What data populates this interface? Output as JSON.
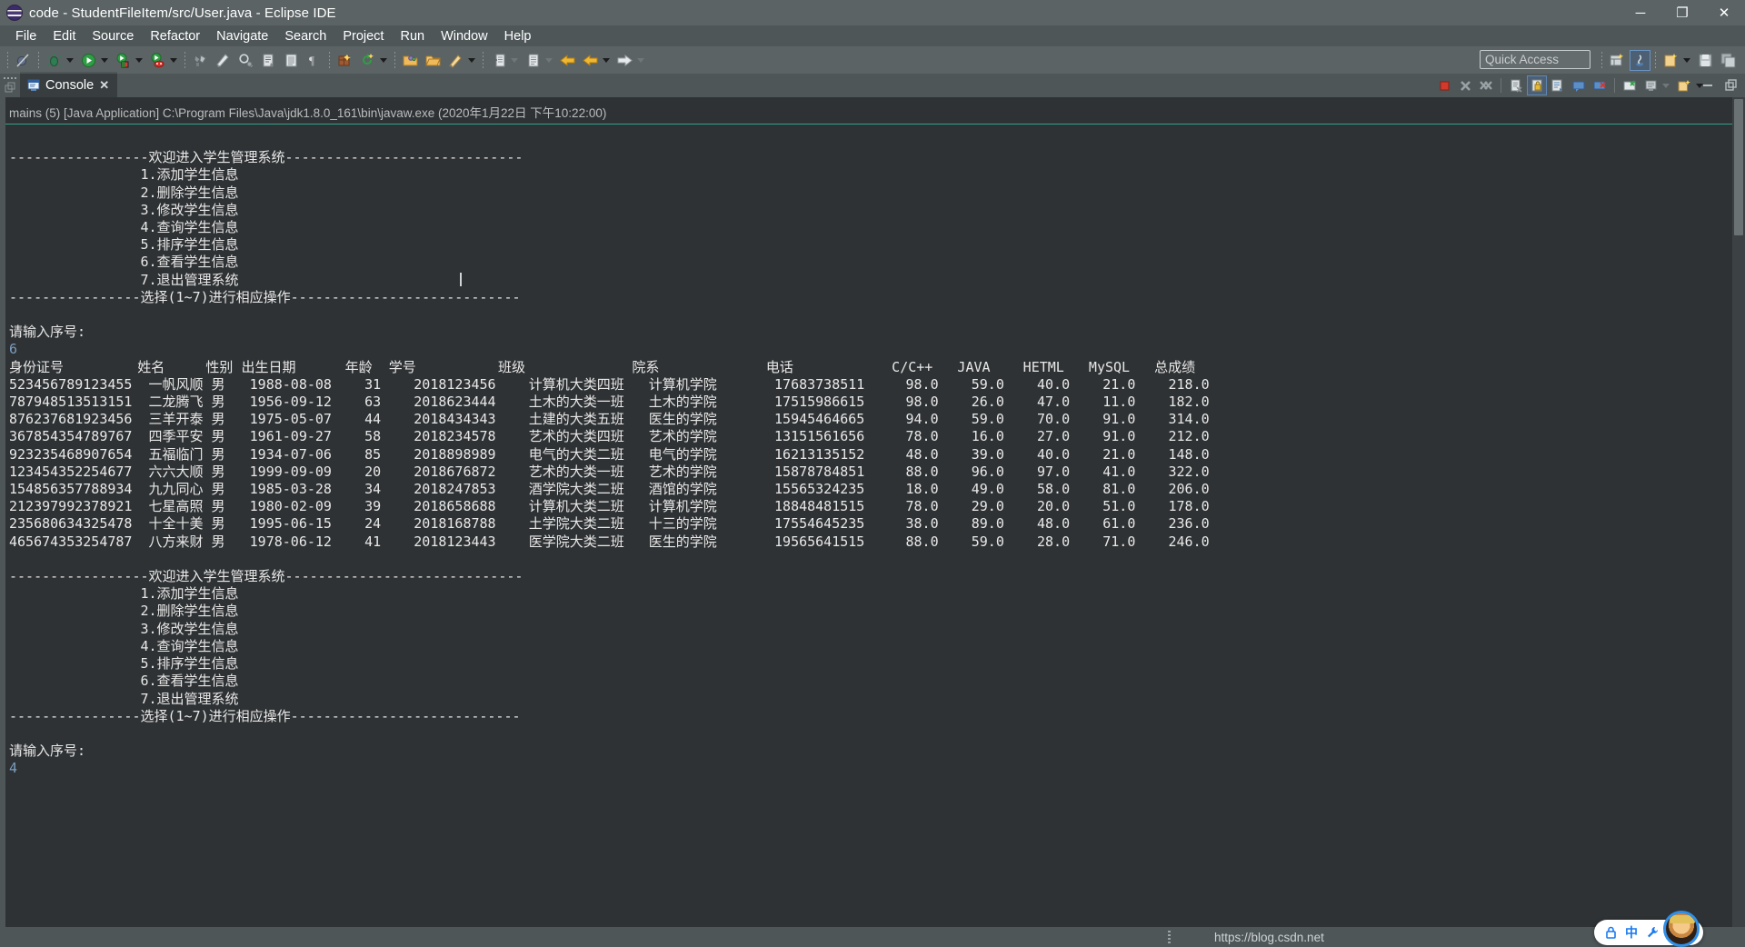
{
  "window": {
    "title": "code - StudentFileItem/src/User.java - Eclipse IDE",
    "app_icon": "eclipse-icon",
    "buttons": {
      "minimize": "─",
      "maximize": "❐",
      "close": "✕"
    }
  },
  "menubar": {
    "items": [
      "File",
      "Edit",
      "Source",
      "Refactor",
      "Navigate",
      "Search",
      "Project",
      "Run",
      "Window",
      "Help"
    ]
  },
  "toolbar": {
    "quick_access_placeholder": "Quick Access",
    "icons": [
      "toggle-breakpoint-icon",
      "debug-icon",
      "run-icon",
      "run-last-tool-icon",
      "external-tools-icon",
      "new-java-project-icon",
      "open-type-icon",
      "search-icon",
      "next-annotation-icon",
      "previous-annotation-icon",
      "paragraph-mark-icon",
      "new-package-icon",
      "refresh-icon",
      "open-folder-icon",
      "open-resource-icon",
      "edit-icon",
      "export-icon",
      "import-icon",
      "back-icon",
      "forward-icon",
      "step-icon"
    ],
    "perspective_icons": [
      "open-perspective-icon",
      "java-perspective-icon",
      "new-wizard-icon",
      "save-icon",
      "save-all-icon"
    ]
  },
  "view": {
    "tab_label": "Console",
    "tab_icon": "console-icon",
    "tab_close": "✕",
    "toolbar_icons": [
      "terminate-icon",
      "remove-launch-icon",
      "remove-all-terminated-icon",
      "clear-console-icon",
      "scroll-lock-icon",
      "word-wrap-icon",
      "show-console-on-output-icon",
      "show-console-on-error-icon",
      "pin-console-icon",
      "display-selected-console-icon",
      "open-console-icon"
    ],
    "minimize_label": "─",
    "maximize_label": "⧉"
  },
  "console": {
    "launch_line": "mains (5) [Java Application] C:\\Program Files\\Java\\jdk1.8.0_161\\bin\\javaw.exe (2020年1月22日 下午10:22:00)",
    "menu_header": "-----------------欢迎进入学生管理系统-----------------------------",
    "menu_items": [
      "                1.添加学生信息",
      "                2.删除学生信息",
      "                3.修改学生信息",
      "                4.查询学生信息",
      "                5.排序学生信息",
      "                6.查看学生信息",
      "                7.退出管理系统"
    ],
    "menu_footer": "----------------选择(1~7)进行相应操作----------------------------",
    "prompt": "请输入序号:",
    "input_first": "6",
    "input_last": "4"
  },
  "table": {
    "headers": [
      "身份证号",
      "姓名",
      "性别",
      "出生日期",
      "年龄",
      "学号",
      "班级",
      "院系",
      "电话",
      "C/C++",
      "JAVA",
      "HETML",
      "MySQL",
      "总成绩"
    ],
    "rows": [
      [
        "523456789123455",
        "一帆风顺",
        "男",
        "1988-08-08",
        "31",
        "2018123456",
        "计算机大类四班",
        "计算机学院",
        "17683738511",
        "98.0",
        "59.0",
        "40.0",
        "21.0",
        "218.0"
      ],
      [
        "787948513513151",
        "二龙腾飞",
        "男",
        "1956-09-12",
        "63",
        "2018623444",
        "土木的大类一班",
        "土木的学院",
        "17515986615",
        "98.0",
        "26.0",
        "47.0",
        "11.0",
        "182.0"
      ],
      [
        "876237681923456",
        "三羊开泰",
        "男",
        "1975-05-07",
        "44",
        "2018434343",
        "土建的大类五班",
        "医生的学院",
        "15945464665",
        "94.0",
        "59.0",
        "70.0",
        "91.0",
        "314.0"
      ],
      [
        "367854354789767",
        "四季平安",
        "男",
        "1961-09-27",
        "58",
        "2018234578",
        "艺术的大类四班",
        "艺术的学院",
        "13151561656",
        "78.0",
        "16.0",
        "27.0",
        "91.0",
        "212.0"
      ],
      [
        "923235468907654",
        "五福临门",
        "男",
        "1934-07-06",
        "85",
        "2018898989",
        "电气的大类二班",
        "电气的学院",
        "16213135152",
        "48.0",
        "39.0",
        "40.0",
        "21.0",
        "148.0"
      ],
      [
        "123454352254677",
        "六六大顺",
        "男",
        "1999-09-09",
        "20",
        "2018676872",
        "艺术的大类一班",
        "艺术的学院",
        "15878784851",
        "88.0",
        "96.0",
        "97.0",
        "41.0",
        "322.0"
      ],
      [
        "154856357788934",
        "九九同心",
        "男",
        "1985-03-28",
        "34",
        "2018247853",
        "酒学院大类二班",
        "酒馆的学院",
        "15565324235",
        "18.0",
        "49.0",
        "58.0",
        "81.0",
        "206.0"
      ],
      [
        "212397992378921",
        "七星高照",
        "男",
        "1980-02-09",
        "39",
        "2018658688",
        "计算机大类二班",
        "计算机学院",
        "18848481515",
        "78.0",
        "29.0",
        "20.0",
        "51.0",
        "178.0"
      ],
      [
        "235680634325478",
        "十全十美",
        "男",
        "1995-06-15",
        "24",
        "2018168788",
        "土学院大类二班",
        "十三的学院",
        "17554645235",
        "38.0",
        "89.0",
        "48.0",
        "61.0",
        "236.0"
      ],
      [
        "465674353254787",
        "八方来财",
        "男",
        "1978-06-12",
        "41",
        "2018123443",
        "医学院大类二班",
        "医生的学院",
        "19565641515",
        "88.0",
        "59.0",
        "28.0",
        "71.0",
        "246.0"
      ]
    ]
  },
  "statusbar": {
    "url": "https://blog.csdn.net"
  },
  "ime": {
    "lock_icon": "lock-icon",
    "mode": "中",
    "tools_icon": "wrench-icon",
    "avatar": "user-avatar"
  },
  "colors": {
    "window_chrome": "#4e5658",
    "titlebar": "#5b6365",
    "console_bg": "#2f3234",
    "console_text": "#e8e8e8",
    "console_input": "#7a9ec2",
    "accent_teal": "#30a08d"
  }
}
